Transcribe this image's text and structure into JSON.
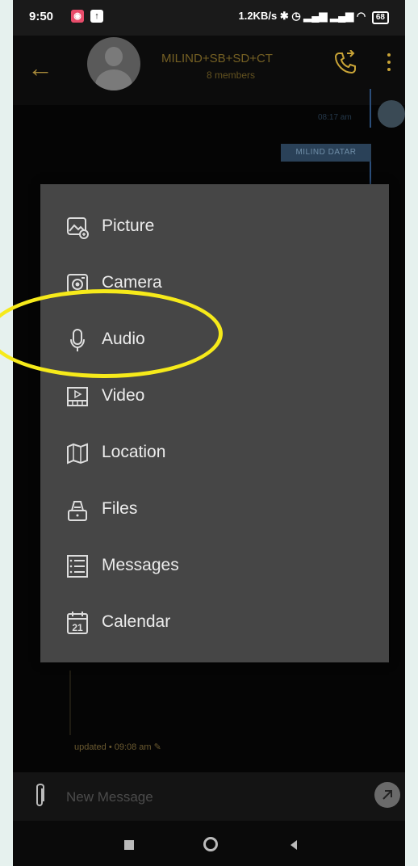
{
  "statusbar": {
    "time": "9:50",
    "right_text": "1.2KB/s",
    "battery": "68",
    "signal_icons": [
      "bluetooth-icon",
      "alarm-icon",
      "signal-icon",
      "vowifi-icon",
      "signal-icon",
      "vowifi-icon",
      "wifi-icon"
    ]
  },
  "header": {
    "group_name": "MILIND+SB+SD+CT",
    "members": "8 members"
  },
  "chat": {
    "time1": "08:17 am",
    "sender": "MILIND DATAR",
    "updated": "updated • 09:08 am"
  },
  "menu": {
    "items": [
      {
        "label": "Picture",
        "icon": "picture-icon"
      },
      {
        "label": "Camera",
        "icon": "camera-icon"
      },
      {
        "label": "Audio",
        "icon": "microphone-icon"
      },
      {
        "label": "Video",
        "icon": "video-icon"
      },
      {
        "label": "Location",
        "icon": "map-icon"
      },
      {
        "label": "Files",
        "icon": "files-icon"
      },
      {
        "label": "Messages",
        "icon": "messages-icon"
      },
      {
        "label": "Calendar",
        "icon": "calendar-icon",
        "badge": "21"
      }
    ]
  },
  "compose": {
    "placeholder": "New Message"
  },
  "colors": {
    "accent": "#c9a437",
    "menu_bg": "#464646",
    "highlight": "#f6ea1a"
  }
}
